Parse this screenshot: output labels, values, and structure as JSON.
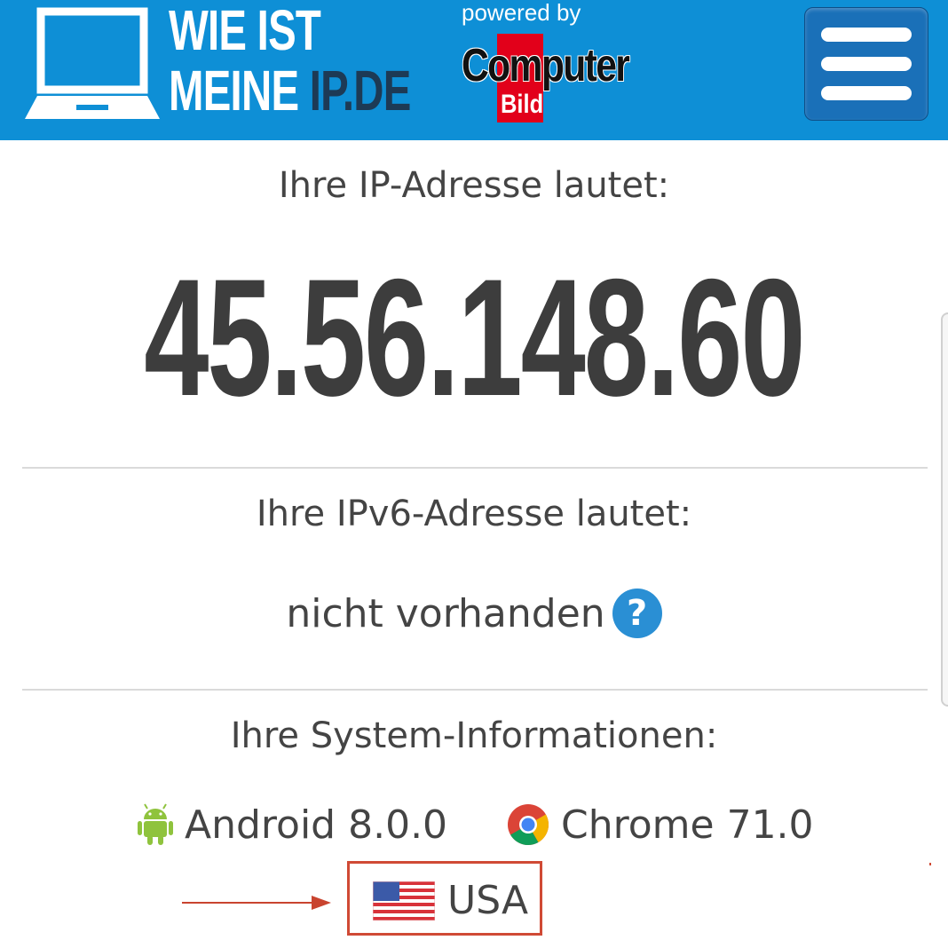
{
  "header": {
    "brand_line1": "WIE IST",
    "brand_line2_a": "MEINE ",
    "brand_line2_b": "IP.DE",
    "powered_by": "powered by",
    "partner_computer": "Computer",
    "partner_bild": "Bild",
    "menu_icon": "hamburger-menu-icon",
    "logo_icon": "laptop-icon"
  },
  "ipv4": {
    "label": "Ihre IP-Adresse lautet:",
    "value": "45.56.148.60"
  },
  "ipv6": {
    "label": "Ihre IPv6-Adresse lautet:",
    "value": "nicht vorhanden",
    "help_symbol": "?"
  },
  "system": {
    "label": "Ihre System-Informationen:",
    "os": "Android 8.0.0",
    "browser": "Chrome 71.0",
    "country": "USA"
  },
  "colors": {
    "header_bg": "#0e8fd6",
    "menu_button": "#1a70b8",
    "text": "#444444",
    "highlight_box": "#d04a35",
    "help_icon": "#2a8fd4"
  }
}
